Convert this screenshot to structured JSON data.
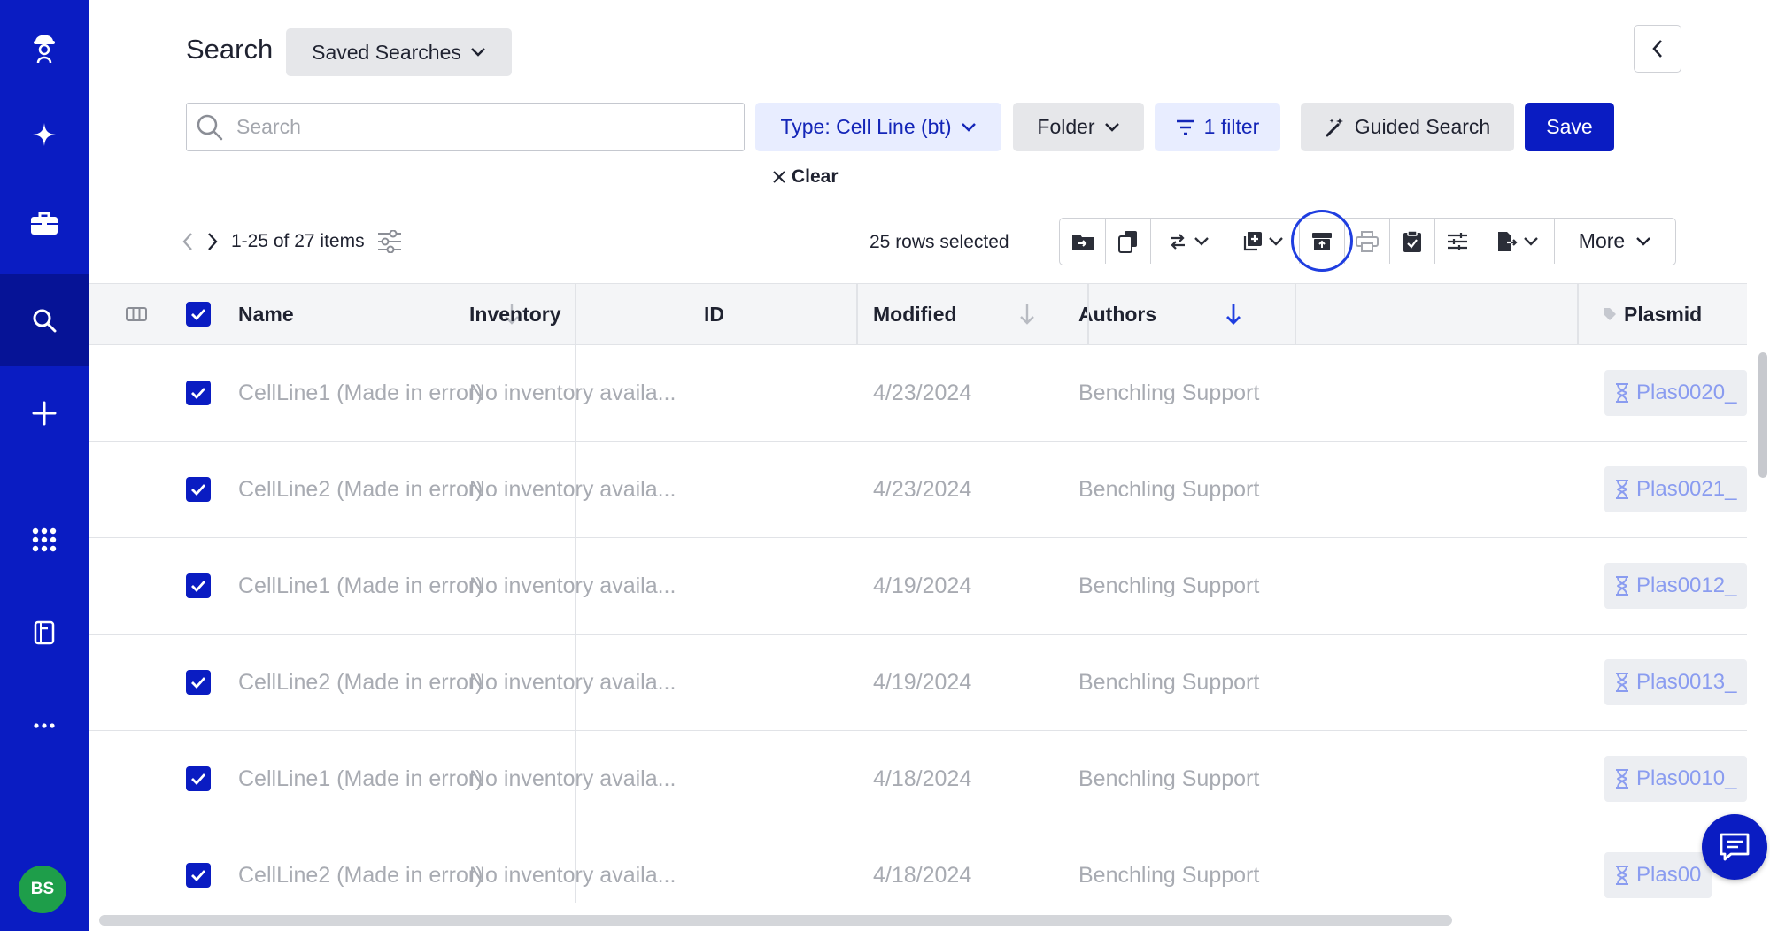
{
  "sidebar": {
    "avatar_initials": "BS",
    "items": [
      {
        "icon": "logo-icon"
      },
      {
        "icon": "sparkle-icon"
      },
      {
        "icon": "briefcase-icon"
      },
      {
        "icon": "search-icon",
        "active": true
      },
      {
        "icon": "plus-icon"
      },
      {
        "icon": "apps-grid-icon"
      },
      {
        "icon": "notebook-icon"
      },
      {
        "icon": "more-horizontal-icon"
      }
    ]
  },
  "header": {
    "title": "Search",
    "saved_searches_label": "Saved Searches"
  },
  "search": {
    "placeholder": "Search",
    "value": "",
    "type_filter_label": "Type: Cell Line (bt)",
    "folder_label": "Folder",
    "filter_label": "1 filter",
    "guided_search_label": "Guided Search",
    "save_label": "Save",
    "clear_label": "Clear"
  },
  "pagination": {
    "range_label": "1-25 of 27 items"
  },
  "selection": {
    "rows_selected_label": "25 rows selected"
  },
  "toolbar": {
    "more_label": "More"
  },
  "table": {
    "columns": {
      "name": "Name",
      "inventory": "Inventory",
      "id": "ID",
      "modified": "Modified",
      "authors": "Authors",
      "plasmid": "Plasmid"
    },
    "rows": [
      {
        "name": "CellLine1 (Made in error)",
        "inventory": "No inventory availa...",
        "id": "",
        "modified": "4/23/2024",
        "authors": "Benchling Support",
        "plasmid": "Plas0020_"
      },
      {
        "name": "CellLine2 (Made in error)",
        "inventory": "No inventory availa...",
        "id": "",
        "modified": "4/23/2024",
        "authors": "Benchling Support",
        "plasmid": "Plas0021_"
      },
      {
        "name": "CellLine1 (Made in error)",
        "inventory": "No inventory availa...",
        "id": "",
        "modified": "4/19/2024",
        "authors": "Benchling Support",
        "plasmid": "Plas0012_"
      },
      {
        "name": "CellLine2 (Made in error)",
        "inventory": "No inventory availa...",
        "id": "",
        "modified": "4/19/2024",
        "authors": "Benchling Support",
        "plasmid": "Plas0013_"
      },
      {
        "name": "CellLine1 (Made in error)",
        "inventory": "No inventory availa...",
        "id": "",
        "modified": "4/18/2024",
        "authors": "Benchling Support",
        "plasmid": "Plas0010_"
      },
      {
        "name": "CellLine2 (Made in error)",
        "inventory": "No inventory availa...",
        "id": "",
        "modified": "4/18/2024",
        "authors": "Benchling Support",
        "plasmid": "Plas00"
      }
    ]
  },
  "colors": {
    "brand": "#0a1cc2",
    "brand_dark": "#061396",
    "accent_light": "#e8edff",
    "avatar": "#1e9e4a",
    "muted_text": "#a8abb2"
  }
}
